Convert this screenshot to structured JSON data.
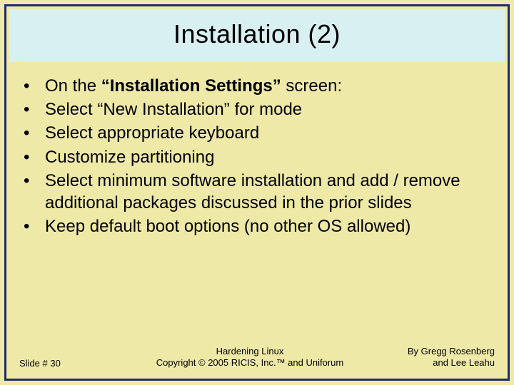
{
  "title": "Installation (2)",
  "bullets": [
    {
      "pre": "On the ",
      "bold": "“Installation Settings”",
      "post": " screen:"
    },
    {
      "text": "Select “New Installation” for mode"
    },
    {
      "text": "Select appropriate keyboard"
    },
    {
      "text": "Customize partitioning"
    },
    {
      "text": "Select minimum software installation and add / remove additional packages discussed in the prior slides"
    },
    {
      "text": "Keep default boot options (no other OS allowed)"
    }
  ],
  "footer": {
    "slide_number": "Slide # 30",
    "center_line1": "Hardening Linux",
    "center_line2": "Copyright © 2005 RICIS, Inc.™ and Uniforum",
    "right_line1": "By Gregg Rosenberg",
    "right_line2": "and Lee Leahu"
  }
}
